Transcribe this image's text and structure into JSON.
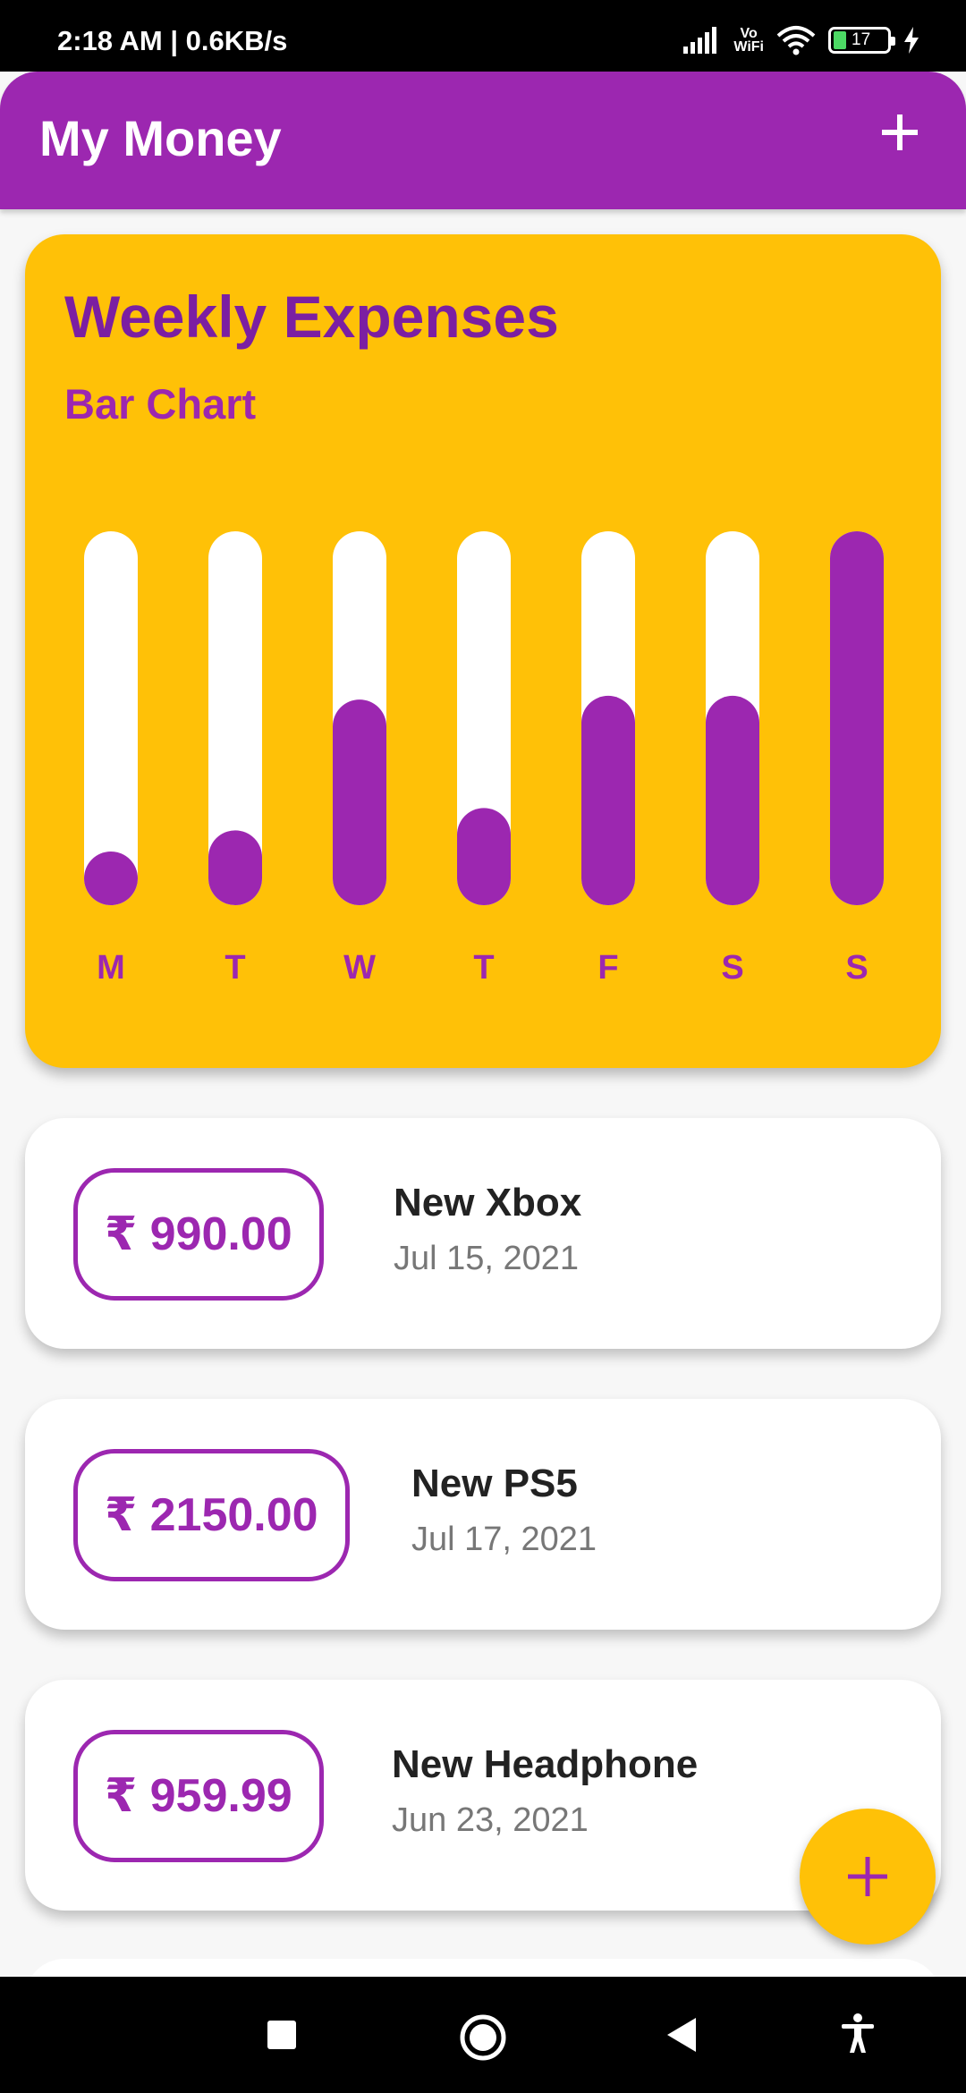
{
  "status_bar": {
    "time_text": "2:18 AM | 0.6KB/s",
    "vowifi_top": "Vo",
    "vowifi_bottom": "WiFi",
    "battery_level": "17"
  },
  "app_bar": {
    "title": "My Money",
    "add_icon": "plus-icon"
  },
  "chart_card": {
    "title": "Weekly Expenses",
    "subtitle": "Bar Chart"
  },
  "chart_data": {
    "type": "bar",
    "title": "Weekly Expenses",
    "subtitle": "Bar Chart",
    "categories": [
      "M",
      "T",
      "W",
      "T",
      "F",
      "S",
      "S"
    ],
    "values": [
      0.14,
      0.2,
      0.55,
      0.26,
      0.56,
      0.56,
      1.0
    ],
    "ylim": [
      0,
      1
    ],
    "colors": {
      "fill": "#9c27b0",
      "track": "#ffffff",
      "background": "#ffc107"
    }
  },
  "expenses": [
    {
      "amount": "₹ 990.00",
      "title": "New Xbox",
      "date": "Jul 15, 2021"
    },
    {
      "amount": "₹ 2150.00",
      "title": "New PS5",
      "date": "Jul 17, 2021"
    },
    {
      "amount": "₹ 959.99",
      "title": "New Headphone",
      "date": "Jun 23, 2021"
    }
  ],
  "fab": {
    "icon": "plus-icon"
  },
  "nav_bar": {
    "recents_icon": "square-icon",
    "home_icon": "circle-icon",
    "back_icon": "triangle-back-icon",
    "accessibility_icon": "accessibility-icon"
  },
  "colors": {
    "primary": "#9c27b0",
    "accent": "#ffc107",
    "title_purple": "#7b1fa2"
  }
}
